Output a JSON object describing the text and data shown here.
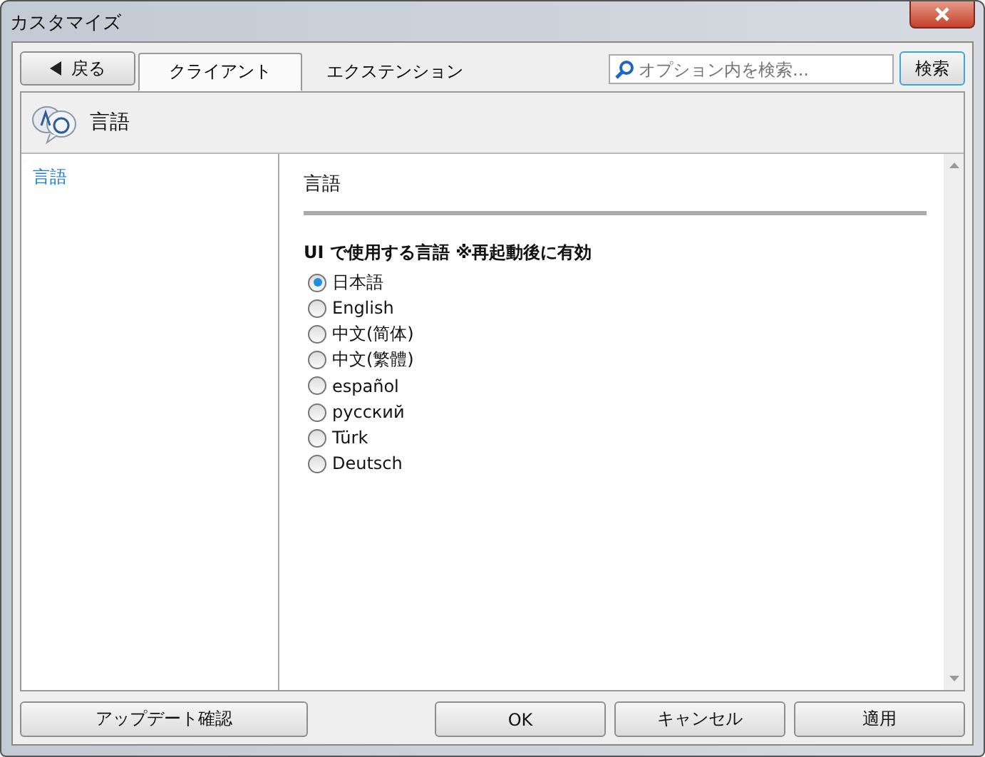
{
  "window": {
    "title": "カスタマイズ"
  },
  "back_button": {
    "label": "戻る"
  },
  "tabs": [
    {
      "label": "クライアント",
      "selected": true
    },
    {
      "label": "エクステンション",
      "selected": false
    }
  ],
  "search": {
    "placeholder": "オプション内を検索...",
    "button": "検索"
  },
  "header": {
    "title": "言語"
  },
  "sidebar": {
    "items": [
      {
        "label": "言語",
        "selected": true
      }
    ]
  },
  "section": {
    "title": "言語",
    "group_label": "UI で使用する言語 ※再起動後に有効",
    "options": [
      {
        "label": "日本語",
        "selected": true
      },
      {
        "label": "English",
        "selected": false
      },
      {
        "label": "中文(简体)",
        "selected": false
      },
      {
        "label": "中文(繁體)",
        "selected": false
      },
      {
        "label": "español",
        "selected": false
      },
      {
        "label": "русский",
        "selected": false
      },
      {
        "label": "Türk",
        "selected": false
      },
      {
        "label": "Deutsch",
        "selected": false
      }
    ]
  },
  "footer": {
    "update_button": "アップデート確認",
    "buttons": [
      "OK",
      "キャンセル",
      "適用"
    ]
  }
}
